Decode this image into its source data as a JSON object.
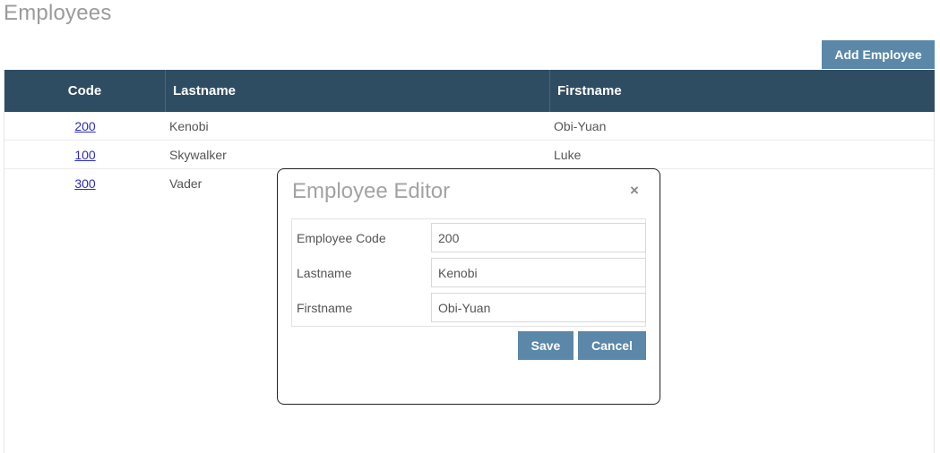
{
  "page": {
    "title": "Employees",
    "add_button_label": "Add Employee"
  },
  "grid": {
    "columns": [
      "Code",
      "Lastname",
      "Firstname"
    ],
    "rows": [
      {
        "code": "200",
        "lastname": "Kenobi",
        "firstname": "Obi-Yuan"
      },
      {
        "code": "100",
        "lastname": "Skywalker",
        "firstname": "Luke"
      },
      {
        "code": "300",
        "lastname": "Vader",
        "firstname": ""
      }
    ]
  },
  "modal": {
    "title": "Employee Editor",
    "close_glyph": "×",
    "fields": [
      {
        "label": "Employee Code",
        "value": "200"
      },
      {
        "label": "Lastname",
        "value": "Kenobi"
      },
      {
        "label": "Firstname",
        "value": "Obi-Yuan"
      }
    ],
    "save_label": "Save",
    "cancel_label": "Cancel"
  },
  "colors": {
    "header_bg": "#2f4d62",
    "button_bg": "#5b88a8",
    "link": "#2b2bbf"
  }
}
